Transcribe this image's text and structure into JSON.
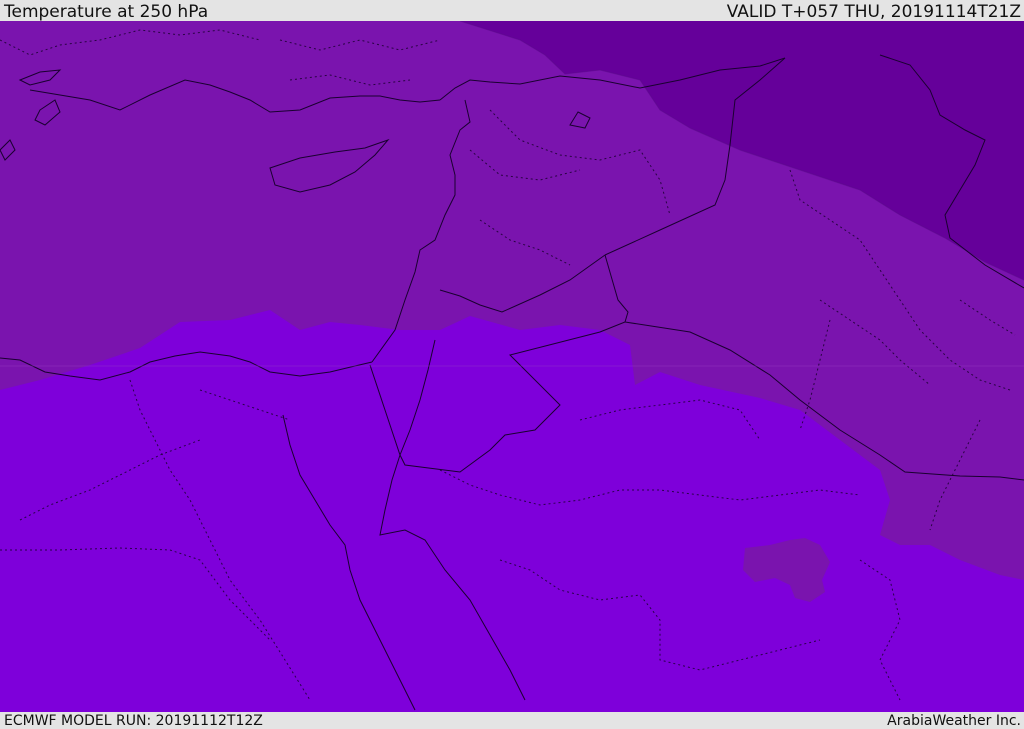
{
  "header": {
    "title": "Temperature at 250 hPa",
    "valid_time": "VALID T+057 THU, 20191114T21Z"
  },
  "footer": {
    "model_run": "ECMWF MODEL RUN: 20191112T12Z",
    "credit": "ArabiaWeather Inc."
  },
  "map": {
    "region": "Eastern Mediterranean, Egypt, Levant, Arabian Peninsula",
    "colors": {
      "warm_band": "#7e00da",
      "mid_band": "#7a14ae",
      "cool_band": "#65009a",
      "boundaries": "#1a0030"
    }
  }
}
